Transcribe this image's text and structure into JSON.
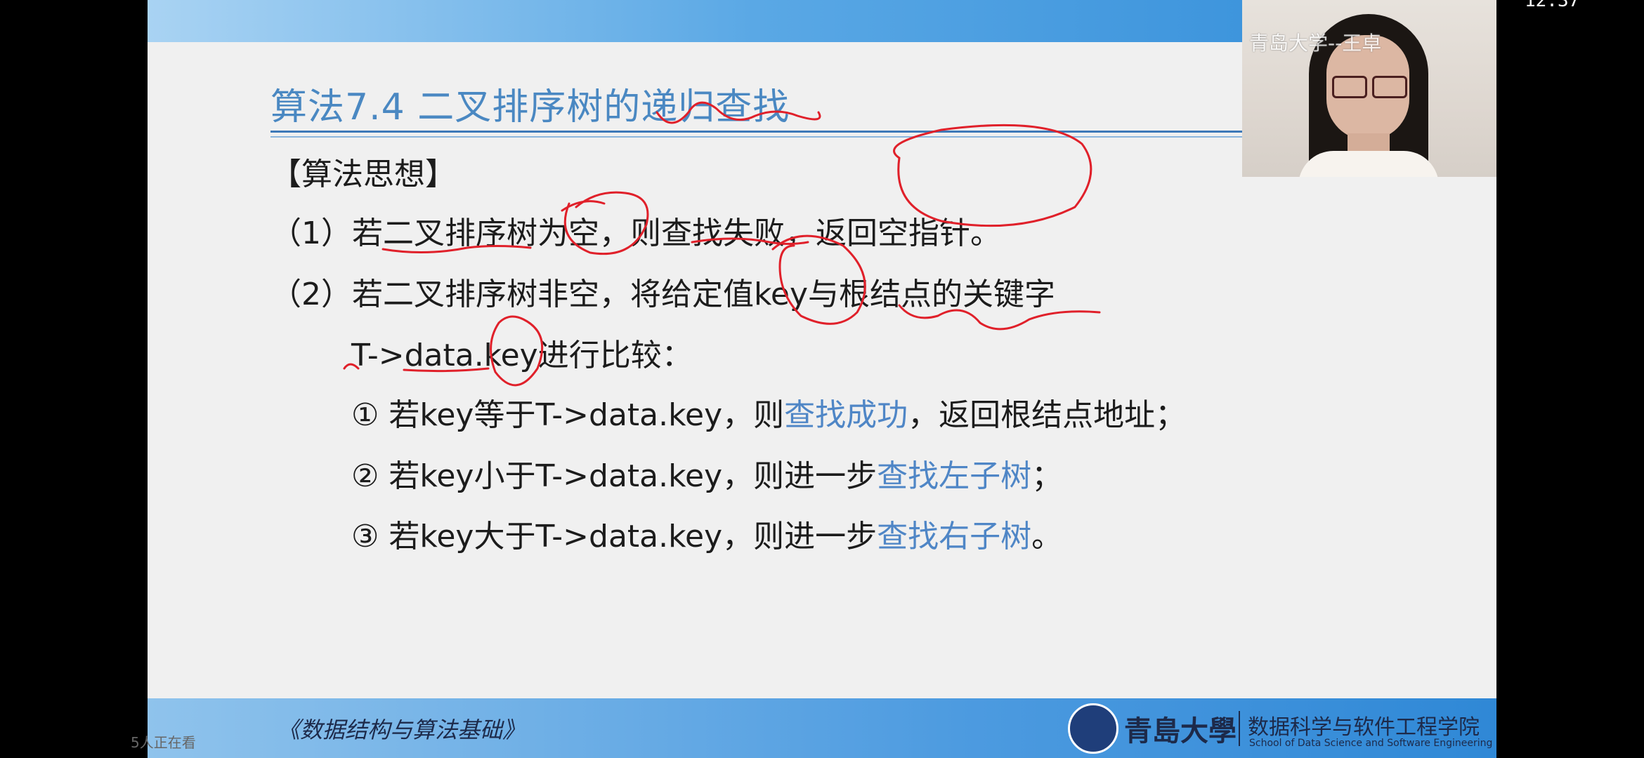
{
  "status_bar": {
    "time": "12:37",
    "app_icon_colors": [
      "#f08a24",
      "#e8413c",
      "#f5a623"
    ]
  },
  "slide": {
    "title": "算法7.4  二叉排序树的递归查找",
    "heading": "【算法思想】",
    "lines": [
      {
        "text": "（1）若二叉排序树为空，则查找失败，返回空指针。"
      },
      {
        "text": "（2）若二叉排序树非空，将给定值key与根结点的关键字"
      },
      {
        "text": "T->data.key进行比较："
      },
      {
        "pre": "① 若key等于T->data.key，则",
        "highlight": "查找成功",
        "post": "，返回根结点地址；"
      },
      {
        "pre": "② 若key小于T->data.key，则进一步",
        "highlight": "查找左子树",
        "post": "；"
      },
      {
        "pre": "③ 若key大于T->data.key，则进一步",
        "highlight": "查找右子树",
        "post": "。"
      }
    ],
    "footer": {
      "course": "《数据结构与算法基础》",
      "university": "青島大學",
      "school_cn": "数据科学与软件工程学院",
      "school_en": "School of Data Science and Software Engineering"
    },
    "colors": {
      "title": "#4a88c2",
      "highlight": "#4f86c6",
      "annotation": "#e0202a"
    }
  },
  "webcam": {
    "label": "青岛大学--王卓"
  },
  "viewers": "5人正在看"
}
